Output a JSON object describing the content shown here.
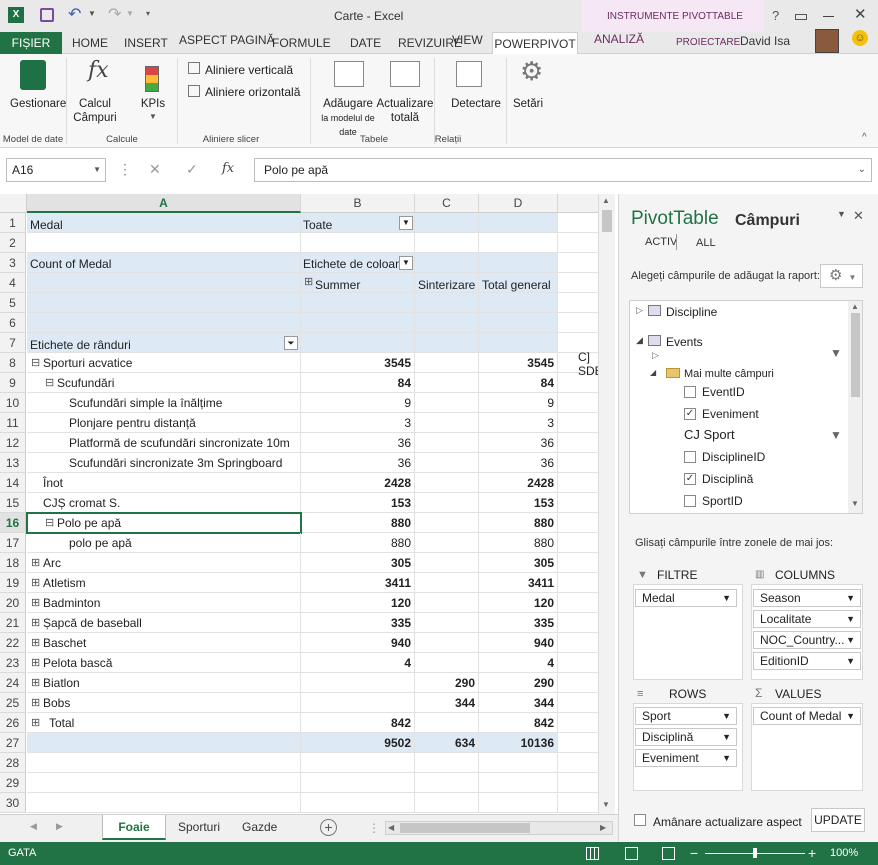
{
  "window": {
    "title": "Carte - Excel",
    "pivot_tools_label": "INSTRUMENTE PIVOTTABLE",
    "user": "David Isa",
    "help": "?"
  },
  "tabs": [
    "FIȘIER",
    "HOME",
    "INSERT",
    "ASPECT PAGINĂ",
    "FORMULE",
    "DATE",
    "REVIZUIRE",
    "VIEW",
    "POWERPIVOT",
    "ANALIZĂ",
    "PROIECTARE"
  ],
  "ribbon": {
    "manage": "Gestionare",
    "calc_fields_1": "Calcul",
    "calc_fields_2": "Câmpuri",
    "kpis": "KPIs",
    "align_vertical": "Aliniere verticală",
    "align_horizontal": "Aliniere orizontală",
    "add_model_1": "Adăugare",
    "add_model_2": "la modelul de date",
    "refresh_1": "Actualizare",
    "refresh_2": "totală",
    "detect": "Detectare",
    "settings": "Setări",
    "groups": {
      "data_model": "Model de date",
      "calculations": "Calcule",
      "slicer_align": "Aliniere slicer",
      "tables": "Tabele",
      "relations": "Relații"
    }
  },
  "formula_bar": {
    "name_box": "A16",
    "fx": "fx",
    "value": "Polo pe apă"
  },
  "columns": [
    "A",
    "B",
    "C",
    "D"
  ],
  "rows": [
    {
      "n": "1",
      "a": "Medal",
      "b": "Toate",
      "c": "",
      "d": ""
    },
    {
      "n": "2",
      "a": "",
      "b": "",
      "c": "",
      "d": ""
    },
    {
      "n": "3",
      "a": "Count of Medal",
      "b": "Etichete de coloane",
      "c": "",
      "d": ""
    },
    {
      "n": "4",
      "a": "",
      "b": "Summer",
      "c": "Sinterizare",
      "d": "Total general"
    },
    {
      "n": "5",
      "a": "",
      "b": "",
      "c": "",
      "d": ""
    },
    {
      "n": "6",
      "a": "",
      "b": "",
      "c": "",
      "d": ""
    },
    {
      "n": "7",
      "a": "Etichete de rânduri",
      "b": "",
      "c": "",
      "d": ""
    },
    {
      "n": "8",
      "a": "Sporturi acvatice",
      "b": "3545",
      "c": "",
      "d": "3545"
    },
    {
      "n": "9",
      "a": "Scufundări",
      "b": "84",
      "c": "",
      "d": "84"
    },
    {
      "n": "10",
      "a": "Scufundări simple la înălțime",
      "b": "9",
      "c": "",
      "d": "9"
    },
    {
      "n": "11",
      "a": "Plonjare pentru distanță",
      "b": "3",
      "c": "",
      "d": "3"
    },
    {
      "n": "12",
      "a": "Platformă de scufundări sincronizate 10m",
      "b": "36",
      "c": "",
      "d": "36"
    },
    {
      "n": "13",
      "a": "Scufundări sincronizate 3m Springboard",
      "b": "36",
      "c": "",
      "d": "36"
    },
    {
      "n": "14",
      "a": "Înot",
      "b": "2428",
      "c": "",
      "d": "2428"
    },
    {
      "n": "15",
      "a": "CJȘ cromat S.",
      "b": "153",
      "c": "",
      "d": "153"
    },
    {
      "n": "16",
      "a": "Polo pe apă",
      "b": "880",
      "c": "",
      "d": "880"
    },
    {
      "n": "17",
      "a": "polo pe apă",
      "b": "880",
      "c": "",
      "d": "880"
    },
    {
      "n": "18",
      "a": "Arc",
      "b": "305",
      "c": "",
      "d": "305"
    },
    {
      "n": "19",
      "a": "Atletism",
      "b": "3411",
      "c": "",
      "d": "3411"
    },
    {
      "n": "20",
      "a": "Badminton",
      "b": "120",
      "c": "",
      "d": "120"
    },
    {
      "n": "21",
      "a": "Șapcă de baseball",
      "b": "335",
      "c": "",
      "d": "335"
    },
    {
      "n": "22",
      "a": "Baschet",
      "b": "940",
      "c": "",
      "d": "940"
    },
    {
      "n": "23",
      "a": "Pelota bască",
      "b": "4",
      "c": "",
      "d": "4"
    },
    {
      "n": "24",
      "a": "Biatlon",
      "b": "",
      "c": "290",
      "d": "290"
    },
    {
      "n": "25",
      "a": "Bobs",
      "b": "",
      "c": "344",
      "d": "344"
    },
    {
      "n": "26",
      "a": "Total",
      "b": "842",
      "c": "",
      "d": "842"
    },
    {
      "n": "27",
      "a": "",
      "b": "9502",
      "c": "634",
      "d": "10136"
    },
    {
      "n": "28",
      "a": "",
      "b": "",
      "c": "",
      "d": ""
    },
    {
      "n": "29",
      "a": "",
      "b": "",
      "c": "",
      "d": ""
    },
    {
      "n": "30",
      "a": "",
      "b": "",
      "c": "",
      "d": ""
    }
  ],
  "overflow_label": "C] SDE",
  "sheet_tabs": [
    "Foaie",
    "Sporturi",
    "Gazde"
  ],
  "status": {
    "ready": "GATA",
    "zoom": "100%"
  },
  "panel": {
    "title_a": "PivotTable",
    "title_b": "Câmpuri",
    "tab_active": "ACTIV",
    "tab_all": "ALL",
    "choose_label": "Alegeți câmpurile de adăugat la raport:",
    "fields": {
      "discipline": "Discipline",
      "events": "Events",
      "more_fields": "Mai multe câmpuri",
      "event_id": "EventID",
      "eveniment": "Eveniment",
      "cj_sport": "CJ Sport",
      "discipline_id": "DisciplineID",
      "disciplina": "Disciplină",
      "sport_id": "SportID"
    },
    "drag_label": "Glisați câmpurile între zonele de mai jos:",
    "filters_title": "FILTRE",
    "columns_title": "COLUMNS",
    "rows_title": "ROWS",
    "values_title": "VALUES",
    "filters": [
      "Medal"
    ],
    "columns": [
      "Season",
      "Localitate",
      "NOC_Country...",
      "EditionID"
    ],
    "rows": [
      "Sport",
      "Disciplină",
      "Eveniment"
    ],
    "values": [
      "Count of Medal"
    ],
    "defer_label": "Amânare actualizare aspect",
    "update": "UPDATE"
  }
}
